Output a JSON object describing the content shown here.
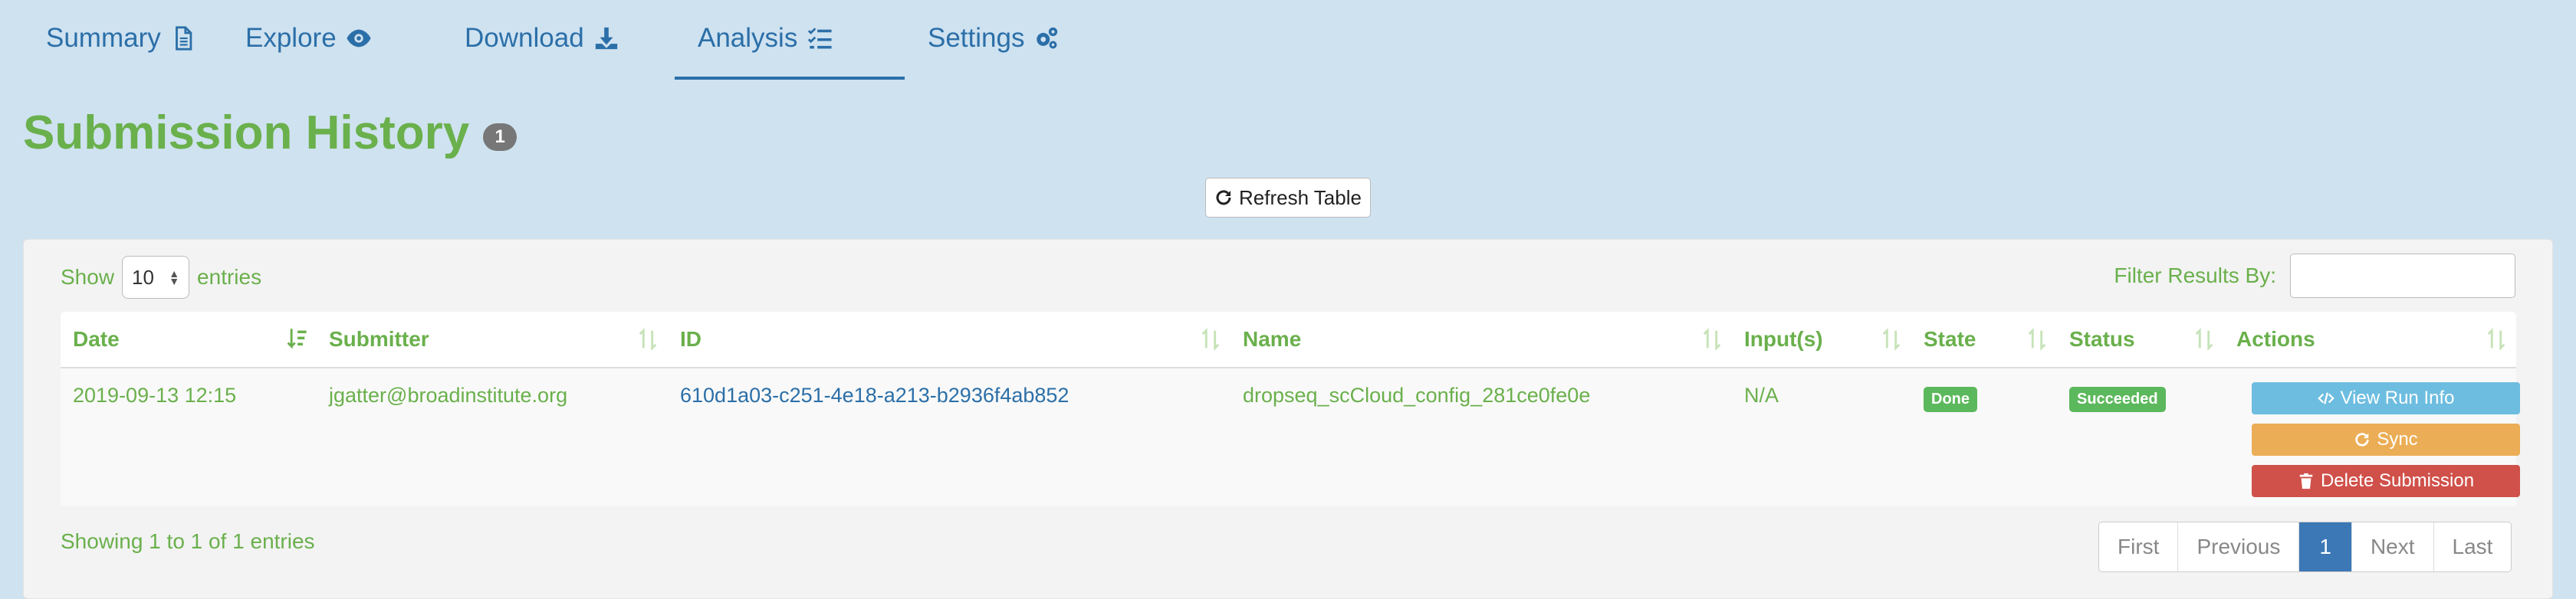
{
  "tabs": [
    {
      "label": "Summary",
      "icon": "document-icon"
    },
    {
      "label": "Explore",
      "icon": "eye-icon"
    },
    {
      "label": "Download",
      "icon": "download-icon"
    },
    {
      "label": "Analysis",
      "icon": "checklist-icon",
      "active": true
    },
    {
      "label": "Settings",
      "icon": "gears-icon"
    }
  ],
  "page": {
    "title": "Submission History",
    "badge_count": "1",
    "refresh_label": "Refresh Table"
  },
  "controls": {
    "show_label": "Show",
    "entries_value": "10",
    "entries_label": "entries",
    "filter_label": "Filter Results By:",
    "filter_value": ""
  },
  "table": {
    "columns": [
      "Date",
      "Submitter",
      "ID",
      "Name",
      "Input(s)",
      "State",
      "Status",
      "Actions"
    ],
    "rows": [
      {
        "date": "2019-09-13 12:15",
        "submitter": "jgatter@broadinstitute.org",
        "id": "610d1a03-c251-4e18-a213-b2936f4ab852",
        "name": "dropseq_scCloud_config_281ce0fe0e",
        "inputs": "N/A",
        "state": "Done",
        "status": "Succeeded",
        "actions": {
          "view": "View Run Info",
          "sync": "Sync",
          "delete": "Delete Submission"
        }
      }
    ]
  },
  "footer": {
    "info": "Showing 1 to 1 of 1 entries",
    "pages": {
      "first": "First",
      "previous": "Previous",
      "current": "1",
      "next": "Next",
      "last": "Last"
    }
  },
  "colors": {
    "accent_green": "#6ab04c",
    "link_blue": "#2b6fa8",
    "info_btn": "#6dbde0",
    "warning_btn": "#ebad55",
    "danger_btn": "#d0504a",
    "success_label": "#5cb85c"
  }
}
